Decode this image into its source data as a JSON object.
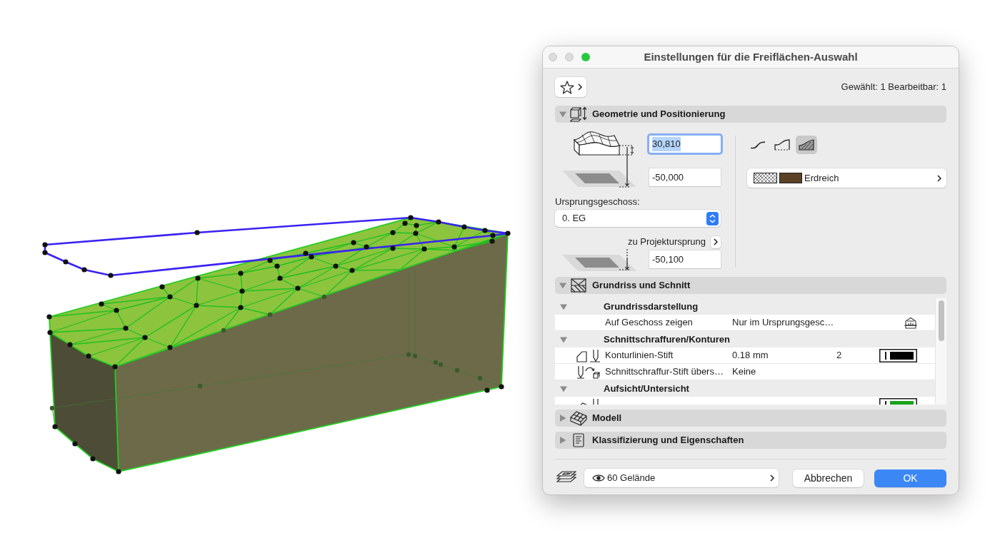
{
  "window": {
    "title": "Einstellungen für die Freiflächen-Auswahl",
    "buttons": [
      {
        "kind": "close",
        "disabled": true
      },
      {
        "kind": "minimize",
        "disabled": true
      },
      {
        "kind": "zoom",
        "disabled": false
      }
    ]
  },
  "selection_info": "Gewählt: 1 Bearbeitbar: 1",
  "sections": [
    {
      "kind": "geometry",
      "title": "Geometrie und Positionierung",
      "expanded": true,
      "top_elevation": {
        "value": "30,810",
        "focused": true
      },
      "bottom_elevation": {
        "value": "-50,000",
        "focused": false
      },
      "home_story_label": "Ursprungsgeschoss:",
      "home_story": "0. EG",
      "reference_label": "zu Projektursprung",
      "reference_elevation": {
        "value": "-50,100",
        "focused": false
      },
      "skin_options": [
        {
          "kind": "surface",
          "selected": false
        },
        {
          "kind": "open",
          "selected": false
        },
        {
          "kind": "solid",
          "selected": true
        }
      ],
      "material": "Erdreich"
    },
    {
      "kind": "plan",
      "title": "Grundriss und Schnitt",
      "expanded": true,
      "groups": [
        {
          "title": "Grundrissdarstellung",
          "expanded": true,
          "rows": [
            {
              "kind": "story",
              "name": "Auf Geschoss zeigen",
              "value": "Nur im Ursprungsgesc…"
            }
          ]
        },
        {
          "title": "Schnittschraffuren/Konturen",
          "expanded": true,
          "rows": [
            {
              "kind": "pen",
              "name": "Konturlinien-Stift",
              "value": "0.18 mm",
              "number": "2",
              "color": "#000000"
            },
            {
              "kind": "override",
              "name": "Schnittschraffur-Stift übers…",
              "value": "Keine"
            }
          ]
        },
        {
          "title": "Aufsicht/Untersicht",
          "expanded": true,
          "rows": [
            {
              "kind": "viewpen",
              "color": "#1ba31b"
            }
          ]
        }
      ]
    },
    {
      "kind": "model",
      "title": "Modell",
      "expanded": false
    },
    {
      "kind": "properties",
      "title": "Klassifizierung und Eigenschaften",
      "expanded": false
    }
  ],
  "footer": {
    "layer": "60 Gelände",
    "buttons": [
      {
        "kind": "cancel",
        "label": "Abbrechen"
      },
      {
        "kind": "default",
        "label": "OK"
      }
    ]
  }
}
